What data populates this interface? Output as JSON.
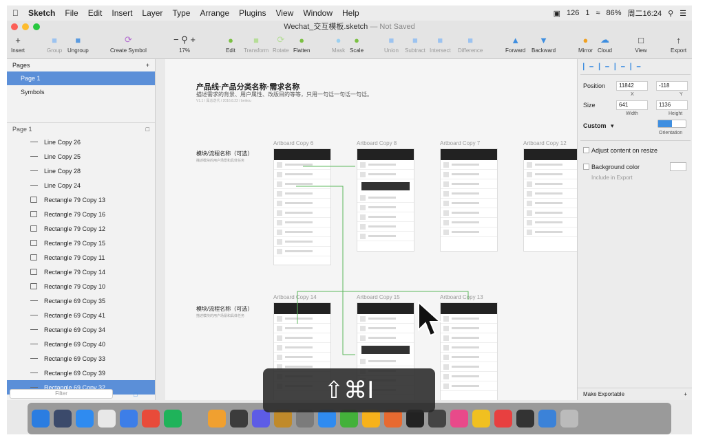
{
  "menubar": {
    "app": "Sketch",
    "items": [
      "File",
      "Edit",
      "Insert",
      "Layer",
      "Type",
      "Arrange",
      "Plugins",
      "View",
      "Window",
      "Help"
    ],
    "status": {
      "count1": "126",
      "count2": "1",
      "battery": "86%",
      "datetime": "周二16:24"
    }
  },
  "window": {
    "title": "Wechat_交互模板.sketch",
    "state": "— Not Saved"
  },
  "toolbar": {
    "insert": "Insert",
    "group": "Group",
    "ungroup": "Ungroup",
    "create_symbol": "Create Symbol",
    "zoom": "17%",
    "edit": "Edit",
    "transform": "Transform",
    "rotate": "Rotate",
    "flatten": "Flatten",
    "mask": "Mask",
    "scale": "Scale",
    "union": "Union",
    "subtract": "Subtract",
    "intersect": "Intersect",
    "difference": "Difference",
    "forward": "Forward",
    "backward": "Backward",
    "mirror": "Mirror",
    "cloud": "Cloud",
    "view": "View",
    "export": "Export"
  },
  "pages": {
    "header": "Pages",
    "items": [
      "Page 1",
      "Symbols"
    ]
  },
  "layers": {
    "header": "Page 1",
    "items": [
      {
        "label": "Line Copy 26",
        "kind": "line"
      },
      {
        "label": "Line Copy 25",
        "kind": "line"
      },
      {
        "label": "Line Copy 28",
        "kind": "line"
      },
      {
        "label": "Line Copy 24",
        "kind": "line"
      },
      {
        "label": "Rectangle 79 Copy 13",
        "kind": "rect"
      },
      {
        "label": "Rectangle 79 Copy 16",
        "kind": "rect"
      },
      {
        "label": "Rectangle 79 Copy 12",
        "kind": "rect"
      },
      {
        "label": "Rectangle 79 Copy 15",
        "kind": "rect"
      },
      {
        "label": "Rectangle 79 Copy 11",
        "kind": "rect"
      },
      {
        "label": "Rectangle 79 Copy 14",
        "kind": "rect"
      },
      {
        "label": "Rectangle 79 Copy 10",
        "kind": "rect"
      },
      {
        "label": "Rectangle 69 Copy 35",
        "kind": "line"
      },
      {
        "label": "Rectangle 69 Copy 41",
        "kind": "line"
      },
      {
        "label": "Rectangle 69 Copy 34",
        "kind": "line"
      },
      {
        "label": "Rectangle 69 Copy 40",
        "kind": "line"
      },
      {
        "label": "Rectangle 69 Copy 33",
        "kind": "line"
      },
      {
        "label": "Rectangle 69 Copy 39",
        "kind": "line"
      },
      {
        "label": "Rectangle 69 Copy 32",
        "kind": "line"
      }
    ],
    "filter_placeholder": "Filter"
  },
  "canvas": {
    "title": "产品线·产品分类名称·需求名称",
    "subtitle": "描述需求的背景、用户属性、改版目的等等，只用一句话一句话一句话。",
    "meta": "V1.1 / 属总迭代 / 2016.8.22 / beikou",
    "section_label": "模块/流程名称（可选）",
    "section_sub": "描述模块的用户场景和具体任务",
    "artboards": [
      "Artboard Copy 6",
      "Artboard Copy 8",
      "Artboard Copy 7",
      "Artboard Copy 12",
      "Artboard Copy 14",
      "Artboard Copy 15",
      "Artboard Copy 13"
    ]
  },
  "inspector": {
    "position_label": "Position",
    "x": "11842",
    "y": "-118",
    "x_label": "X",
    "y_label": "Y",
    "size_label": "Size",
    "width": "641",
    "height": "1136",
    "width_label": "Width",
    "height_label": "Height",
    "preset": "Custom",
    "orientation": "Orientation",
    "adjust": "Adjust content on resize",
    "bg_color": "Background color",
    "include_export": "Include in Export",
    "make_exportable": "Make Exportable"
  },
  "overlay": {
    "shortcut": "⇧⌘I"
  }
}
